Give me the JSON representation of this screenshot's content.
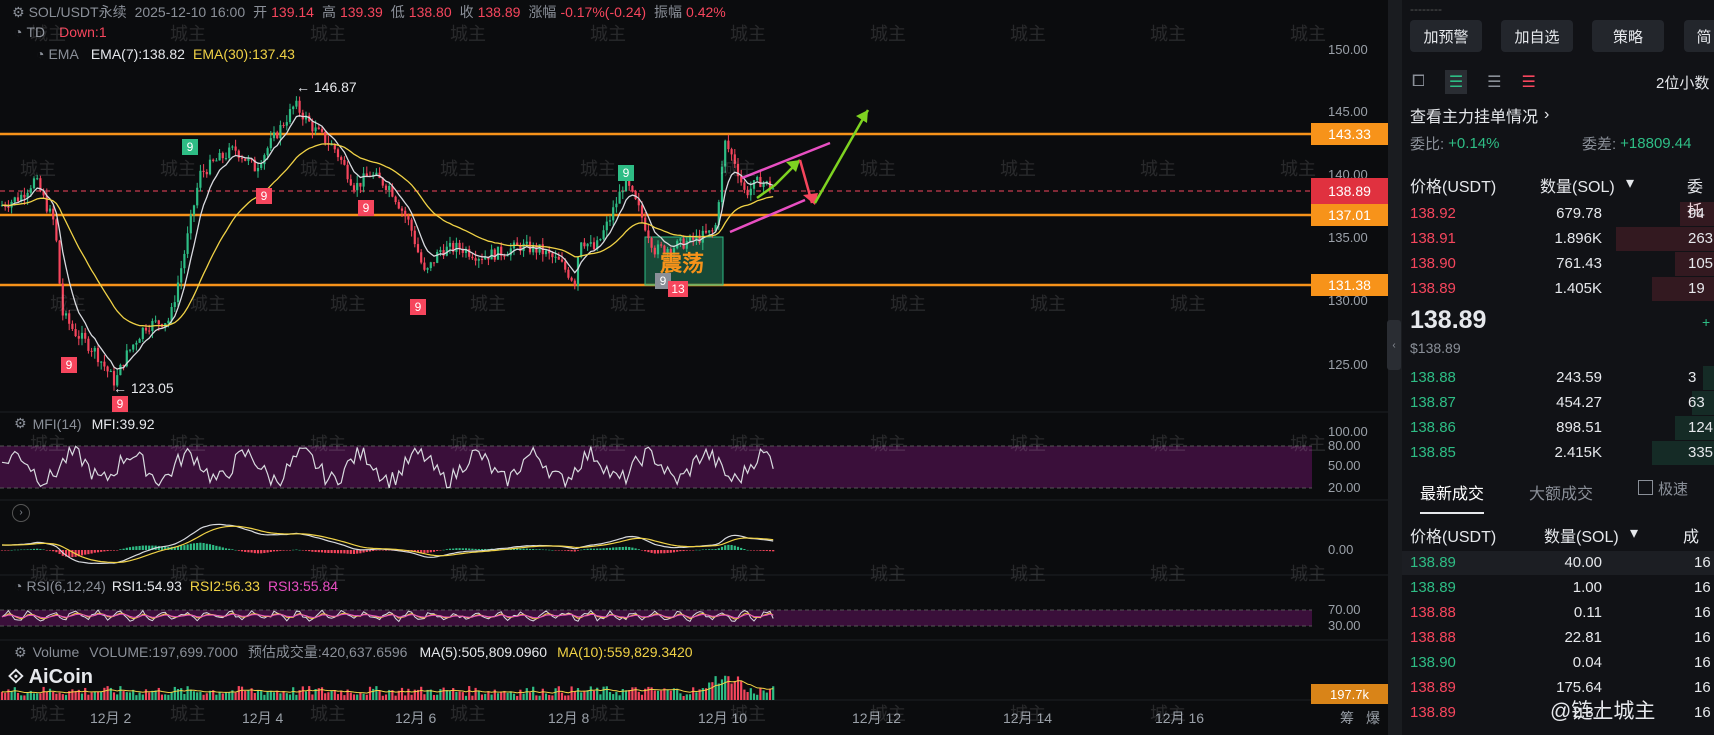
{
  "header": {
    "symbol": "SOL/USDT永续",
    "datetime": "2025-12-10 16:00",
    "open_label": "开",
    "open": "139.14",
    "high_label": "高",
    "high": "139.39",
    "low_label": "低",
    "low": "138.80",
    "close_label": "收",
    "close": "138.89",
    "change_label": "涨幅",
    "change": "-0.17%(-0.24)",
    "amp_label": "振幅",
    "amp": "0.42%"
  },
  "indicators": {
    "td_name": "TD",
    "td_value": "Down:1",
    "ema_name": "EMA",
    "ema7": "EMA(7):138.82",
    "ema30": "EMA(30):137.43",
    "mfi_name": "MFI(14)",
    "mfi_value": "MFI:39.92",
    "rsi_name": "RSI(6,12,24)",
    "rsi1": "RSI1:54.93",
    "rsi2": "RSI2:56.33",
    "rsi3": "RSI3:55.84",
    "volume_name": "Volume",
    "volume_value": "VOLUME:197,699.7000",
    "est_volume": "预估成交量:420,637.6596",
    "vol_ma5": "MA(5):505,809.0960",
    "vol_ma10": "MA(10):559,829.3420"
  },
  "annotations": {
    "high_mark": "← 146.87",
    "low_mark": "← 123.05",
    "range_box": "震荡",
    "td_nine": "9",
    "td_thirteen": "13"
  },
  "price_levels": {
    "resistance_high": "143.33",
    "current": "138.89",
    "support_mid": "137.01",
    "support_low": "131.38"
  },
  "price_axis": [
    "150.00",
    "145.00",
    "140.00",
    "135.00",
    "130.00",
    "125.00"
  ],
  "mfi_axis": [
    "100.00",
    "80.00",
    "50.00",
    "20.00"
  ],
  "macd_axis": [
    "0.00"
  ],
  "rsi_axis": [
    "70.00",
    "30.00"
  ],
  "volume_tag": "197.7k",
  "time_axis": [
    "12月 2",
    "12月 4",
    "12月 6",
    "12月 8",
    "12月 10",
    "12月 12",
    "12月 14",
    "12月 16"
  ],
  "bottom_right": [
    "筹",
    "爆"
  ],
  "logo_text": "AiCoin",
  "watermark_text": "城主",
  "footer_watermark": "@链上城主",
  "panel": {
    "top_buttons": [
      "加预警",
      "加自选",
      "策略",
      "简"
    ],
    "decimals": "2位小数",
    "main_orders_link": "查看主力挂单情况",
    "ratio_label": "委比:",
    "ratio_value": "+0.14%",
    "diff_label": "委差:",
    "diff_value": "+18809.44",
    "col_price": "价格(USDT)",
    "col_qty": "数量(SOL)",
    "col_total": "委托",
    "asks": [
      {
        "price": "138.92",
        "qty": "679.78",
        "total": "94",
        "depth": 0.12
      },
      {
        "price": "138.91",
        "qty": "1.896K",
        "total": "263",
        "depth": 0.35
      },
      {
        "price": "138.90",
        "qty": "761.43",
        "total": "105",
        "depth": 0.14
      },
      {
        "price": "138.89",
        "qty": "1.405K",
        "total": "19",
        "depth": 0.22
      }
    ],
    "last_price": "138.89",
    "last_price_usd": "$138.89",
    "bids": [
      {
        "price": "138.88",
        "qty": "243.59",
        "total": "3",
        "depth": 0.04
      },
      {
        "price": "138.87",
        "qty": "454.27",
        "total": "63",
        "depth": 0.08
      },
      {
        "price": "138.86",
        "qty": "898.51",
        "total": "124",
        "depth": 0.14
      },
      {
        "price": "138.85",
        "qty": "2.415K",
        "total": "335",
        "depth": 0.22
      }
    ],
    "trades_tabs": [
      "最新成交",
      "大额成交"
    ],
    "fast_label": "极速",
    "trade_col_price": "价格(USDT)",
    "trade_col_qty": "数量(SOL)",
    "trade_col_time": "成交",
    "trades": [
      {
        "price": "138.89",
        "qty": "40.00",
        "time": "16",
        "side": "up"
      },
      {
        "price": "138.89",
        "qty": "1.00",
        "time": "16",
        "side": "up"
      },
      {
        "price": "138.88",
        "qty": "0.11",
        "time": "16",
        "side": "down"
      },
      {
        "price": "138.88",
        "qty": "22.81",
        "time": "16",
        "side": "down"
      },
      {
        "price": "138.90",
        "qty": "0.04",
        "time": "16",
        "side": "up"
      },
      {
        "price": "138.89",
        "qty": "175.64",
        "time": "16",
        "side": "down"
      },
      {
        "price": "138.89",
        "qty": "2.37",
        "time": "16",
        "side": "down"
      }
    ]
  },
  "colors": {
    "up": "#2ebd85",
    "down": "#f6465d",
    "level": "#f7931a",
    "ema7": "#e6e8ec",
    "ema30": "#f0d246",
    "pink": "#e84fc2",
    "arrow_green": "#7ed321"
  }
}
